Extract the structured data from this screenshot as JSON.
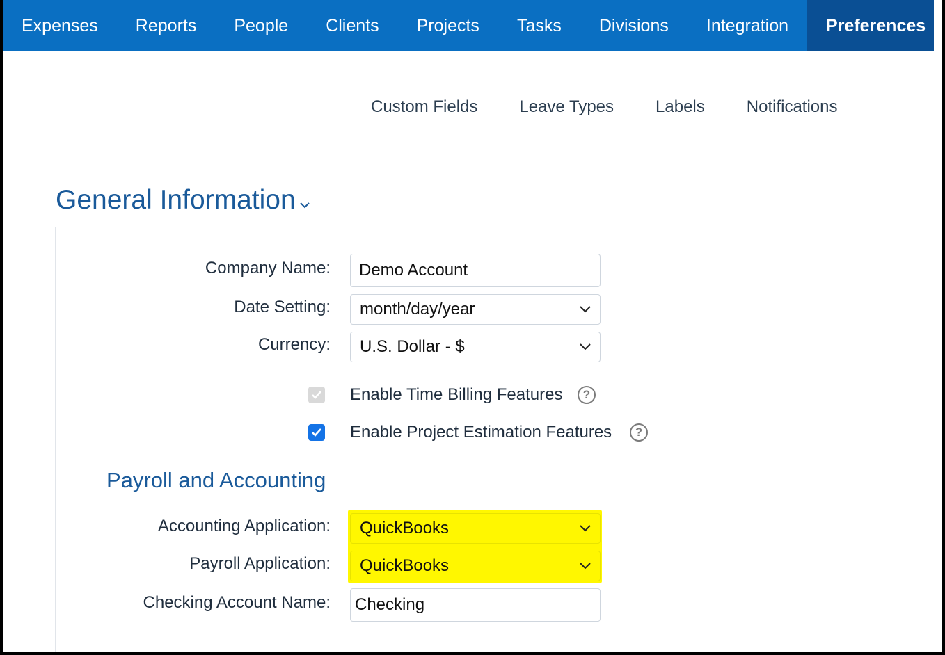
{
  "nav": {
    "items": [
      {
        "label": "Expenses"
      },
      {
        "label": "Reports"
      },
      {
        "label": "People"
      },
      {
        "label": "Clients"
      },
      {
        "label": "Projects"
      },
      {
        "label": "Tasks"
      },
      {
        "label": "Divisions"
      },
      {
        "label": "Integration"
      },
      {
        "label": "Preferences"
      }
    ],
    "active": "Preferences",
    "color": "#0a6fc2",
    "active_color": "#0a4f94"
  },
  "subnav": {
    "items": [
      {
        "label": "Custom Fields"
      },
      {
        "label": "Leave Types"
      },
      {
        "label": "Labels"
      },
      {
        "label": "Notifications"
      }
    ]
  },
  "general": {
    "title": "General Information",
    "company_name_label": "Company Name:",
    "company_name_value": "Demo Account",
    "date_setting_label": "Date Setting:",
    "date_setting_value": "month/day/year",
    "currency_label": "Currency:",
    "currency_value": "U.S. Dollar - $",
    "time_billing_label": "Enable Time Billing Features",
    "time_billing_checked": true,
    "time_billing_disabled": true,
    "project_estimation_label": "Enable Project Estimation Features",
    "project_estimation_checked": true
  },
  "payroll": {
    "title": "Payroll and Accounting",
    "accounting_app_label": "Accounting Application:",
    "accounting_app_value": "QuickBooks",
    "payroll_app_label": "Payroll Application:",
    "payroll_app_value": "QuickBooks",
    "checking_account_label": "Checking Account Name:",
    "checking_account_value": "Checking",
    "highlight_color": "#fff700"
  },
  "icons": {
    "help": "help-circle-icon",
    "caret": "chevron-down-icon",
    "check": "checkmark-icon"
  }
}
